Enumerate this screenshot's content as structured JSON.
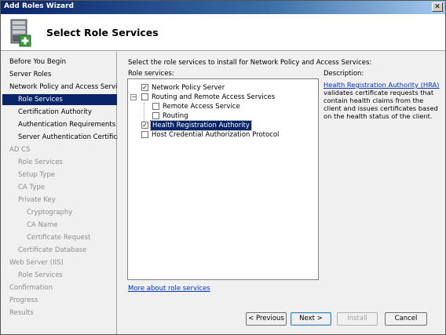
{
  "window": {
    "title": "Add Roles Wizard",
    "close_glyph": "✕"
  },
  "header": {
    "title": "Select Role Services",
    "icon": "server-roles-add-icon"
  },
  "sidebar": {
    "items": [
      {
        "label": "Before You Begin",
        "level": 0,
        "state": "normal"
      },
      {
        "label": "Server Roles",
        "level": 0,
        "state": "normal"
      },
      {
        "label": "Network Policy and Access Services",
        "level": 0,
        "state": "normal"
      },
      {
        "label": "Role Services",
        "level": 1,
        "state": "selected"
      },
      {
        "label": "Certification Authority",
        "level": 1,
        "state": "normal"
      },
      {
        "label": "Authentication Requirements",
        "level": 1,
        "state": "normal"
      },
      {
        "label": "Server Authentication Certificate",
        "level": 1,
        "state": "normal"
      },
      {
        "label": "AD CS",
        "level": 0,
        "state": "disabled"
      },
      {
        "label": "Role Services",
        "level": 1,
        "state": "disabled"
      },
      {
        "label": "Setup Type",
        "level": 1,
        "state": "disabled"
      },
      {
        "label": "CA Type",
        "level": 1,
        "state": "disabled"
      },
      {
        "label": "Private Key",
        "level": 1,
        "state": "disabled"
      },
      {
        "label": "Cryptography",
        "level": 2,
        "state": "disabled"
      },
      {
        "label": "CA Name",
        "level": 2,
        "state": "disabled"
      },
      {
        "label": "Certificate Request",
        "level": 2,
        "state": "disabled"
      },
      {
        "label": "Certificate Database",
        "level": 1,
        "state": "disabled"
      },
      {
        "label": "Web Server (IIS)",
        "level": 0,
        "state": "disabled"
      },
      {
        "label": "Role Services",
        "level": 1,
        "state": "disabled"
      },
      {
        "label": "Confirmation",
        "level": 0,
        "state": "disabled"
      },
      {
        "label": "Progress",
        "level": 0,
        "state": "disabled"
      },
      {
        "label": "Results",
        "level": 0,
        "state": "disabled"
      }
    ]
  },
  "content": {
    "instruction": "Select the role services to install for Network Policy and Access Services:",
    "role_services_label": "Role services:",
    "description_label": "Description:",
    "tree": [
      {
        "label": "Network Policy Server",
        "checked": true
      },
      {
        "label": "Routing and Remote Access Services",
        "checked": false,
        "expander": "−"
      },
      {
        "label": "Remote Access Service",
        "checked": false
      },
      {
        "label": "Routing",
        "checked": false
      },
      {
        "label": "Health Registration Authority",
        "checked": true,
        "selected": true
      },
      {
        "label": "Host Credential Authorization Protocol",
        "checked": false
      }
    ],
    "check_glyph": "✓",
    "more_link": "More about role services",
    "description_link": "Health Registration Authority (HRA)",
    "description_text": " validates certificate requests that contain health claims from the client and issues certificates based on the health status of the client."
  },
  "buttons": {
    "previous": "< Previous",
    "next": "Next >",
    "install": "Install",
    "cancel": "Cancel"
  }
}
